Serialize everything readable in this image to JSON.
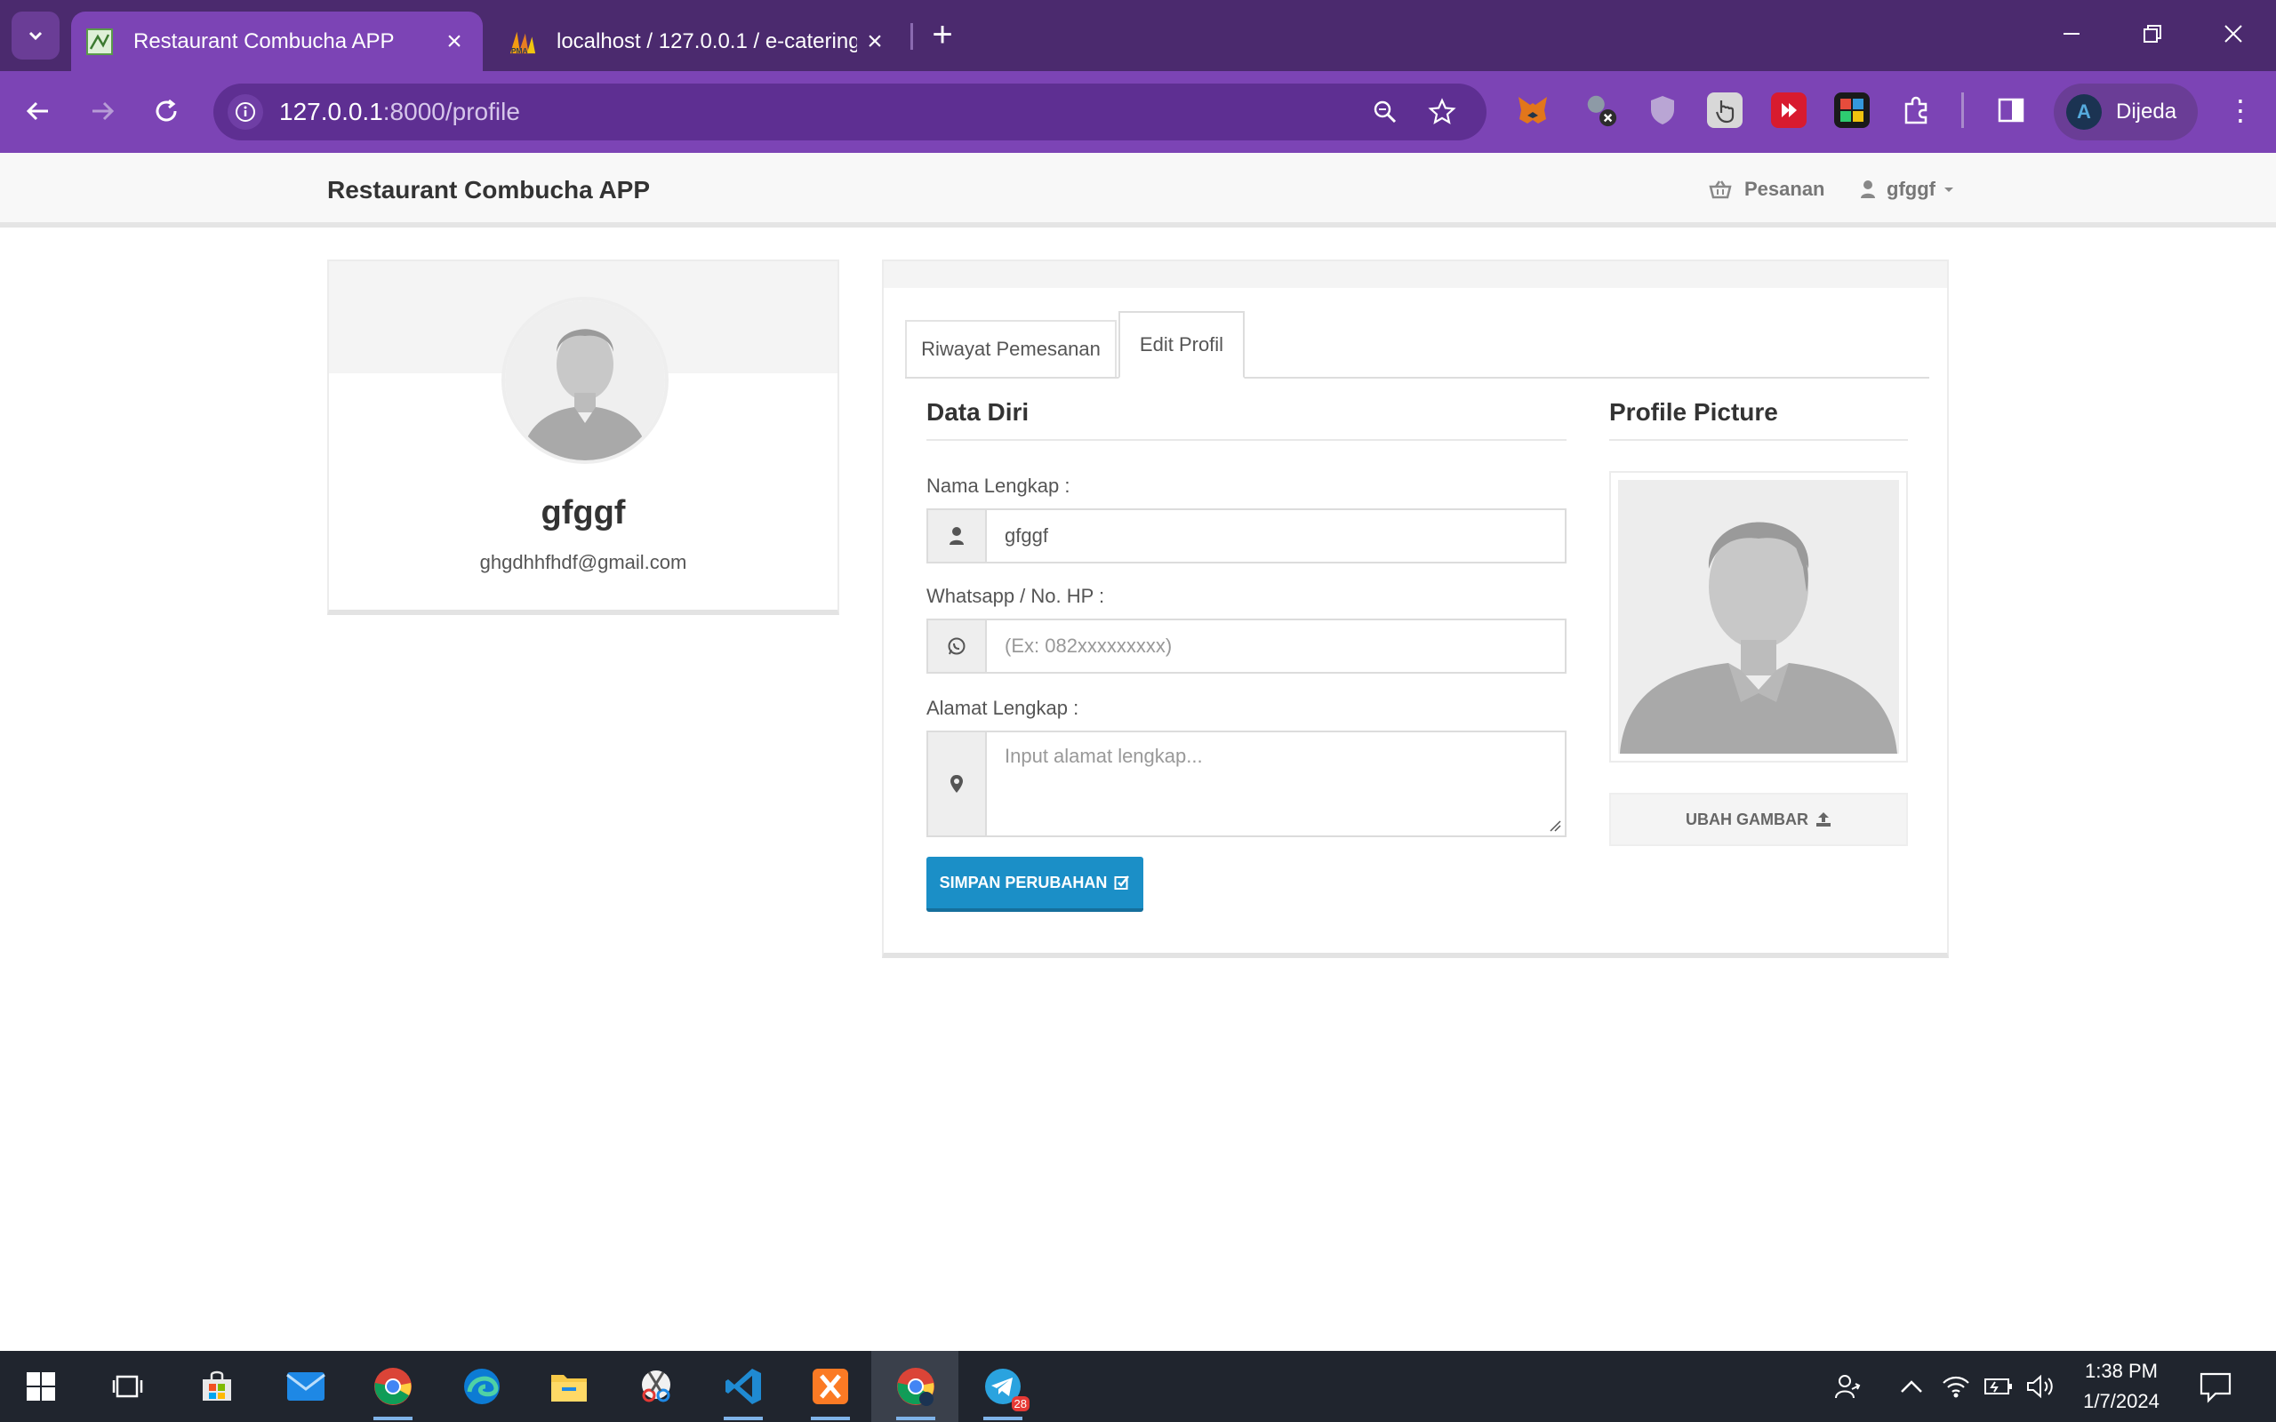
{
  "browser": {
    "tabs": [
      {
        "title": "Restaurant Combucha APP",
        "active": true
      },
      {
        "title": "localhost / 127.0.0.1 / e-catering",
        "active": false
      }
    ],
    "url_host": "127.0.0.1",
    "url_path": ":8000/profile",
    "profile_name": "Dijeda"
  },
  "navbar": {
    "brand": "Restaurant Combucha APP",
    "orders_label": "Pesanan",
    "user_label": "gfggf"
  },
  "profile_card": {
    "name": "gfggf",
    "email": "ghgdhhfhdf@gmail.com"
  },
  "tabs": {
    "history": "Riwayat Pemesanan",
    "edit": "Edit Profil"
  },
  "form": {
    "section_title": "Data Diri",
    "name_label": "Nama Lengkap :",
    "name_value": "gfggf",
    "phone_label": "Whatsapp / No. HP :",
    "phone_placeholder": "(Ex: 082xxxxxxxxx)",
    "address_label": "Alamat Lengkap :",
    "address_placeholder": "Input alamat lengkap...",
    "save_button": "SIMPAN PERUBAHAN"
  },
  "picture": {
    "section_title": "Profile Picture",
    "change_button": "UBAH GAMBAR"
  },
  "taskbar": {
    "time": "1:38 PM",
    "date": "1/7/2024",
    "telegram_badge": "28"
  },
  "colors": {
    "browser_frame": "#4b2a6e",
    "browser_toolbar": "#7c44b5",
    "primary_button": "#1b8fc7",
    "taskbar": "#20252e"
  }
}
